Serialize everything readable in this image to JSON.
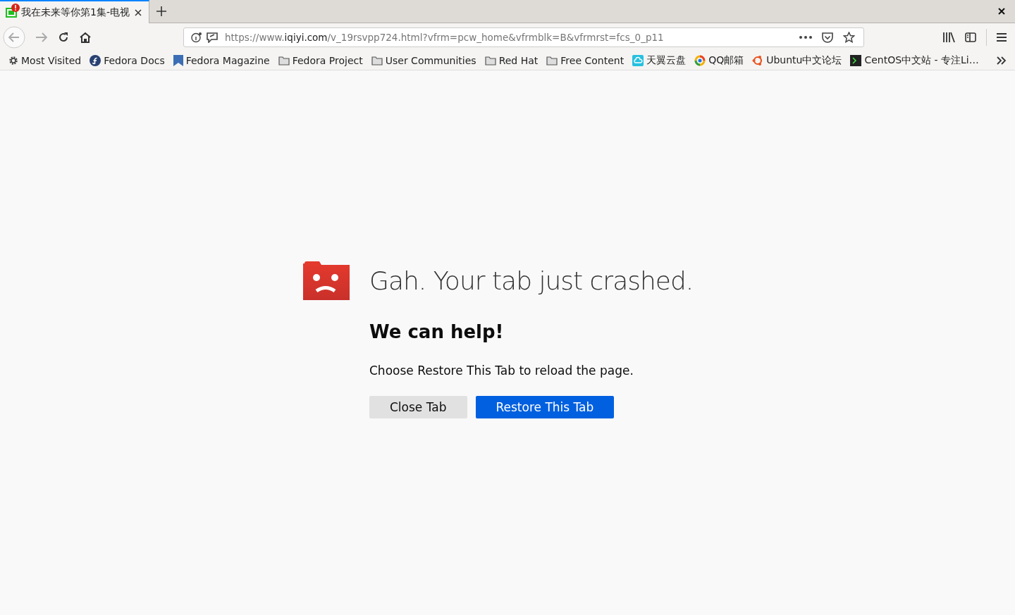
{
  "tabs": [
    {
      "title": "我在未来等你第1集-电视",
      "selected": true,
      "crashed": true
    }
  ],
  "url": {
    "prefix": "https://www.",
    "domain": "iqiyi.com",
    "path": "/v_19rsvpp724.html?vfrm=pcw_home&vfrmblk=B&vfrmrst=fcs_0_p11"
  },
  "bookmarks": [
    {
      "label": "Most Visited",
      "kind": "gear"
    },
    {
      "label": "Fedora Docs",
      "kind": "fedora"
    },
    {
      "label": "Fedora Magazine",
      "kind": "magazine"
    },
    {
      "label": "Fedora Project",
      "kind": "folder"
    },
    {
      "label": "User Communities",
      "kind": "folder"
    },
    {
      "label": "Red Hat",
      "kind": "folder"
    },
    {
      "label": "Free Content",
      "kind": "folder"
    },
    {
      "label": "天翼云盘",
      "kind": "cloud"
    },
    {
      "label": "QQ邮箱",
      "kind": "qq"
    },
    {
      "label": "Ubuntu中文论坛",
      "kind": "ubuntu"
    },
    {
      "label": "CentOS中文站 - 专注Li…",
      "kind": "terminal"
    }
  ],
  "page": {
    "title": "Gah. Your tab just crashed.",
    "heading": "We can help!",
    "message": "Choose Restore This Tab to reload the page.",
    "buttons": [
      {
        "label": "Close Tab",
        "kind": "secondary"
      },
      {
        "label": "Restore This Tab",
        "kind": "primary"
      }
    ]
  }
}
